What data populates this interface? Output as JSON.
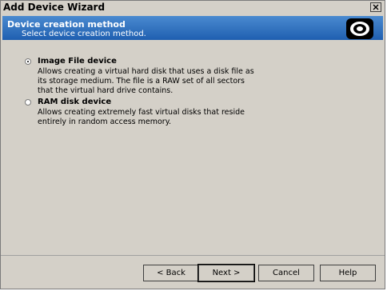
{
  "window": {
    "title": "Add Device Wizard"
  },
  "header": {
    "title": "Device creation method",
    "subtitle": "Select device creation method."
  },
  "options": [
    {
      "label": "Image File device",
      "checked": true,
      "description": "Allows creating a virtual hard disk that uses a disk file as its storage medium. The file is a RAW set of all sectors that the virtual hard drive contains."
    },
    {
      "label": "RAM disk device",
      "checked": false,
      "description": "Allows creating extremely fast virtual disks that reside entirely in random access memory."
    }
  ],
  "buttons": {
    "back": "< Back",
    "next": "Next >",
    "cancel": "Cancel",
    "help": "Help"
  },
  "icons": {
    "close": "close-icon",
    "disk": "disk-icon",
    "radio": "radio-icon"
  },
  "colors": {
    "header_band": "#2a6cbf",
    "dialog_bg": "#d4d0c8"
  }
}
